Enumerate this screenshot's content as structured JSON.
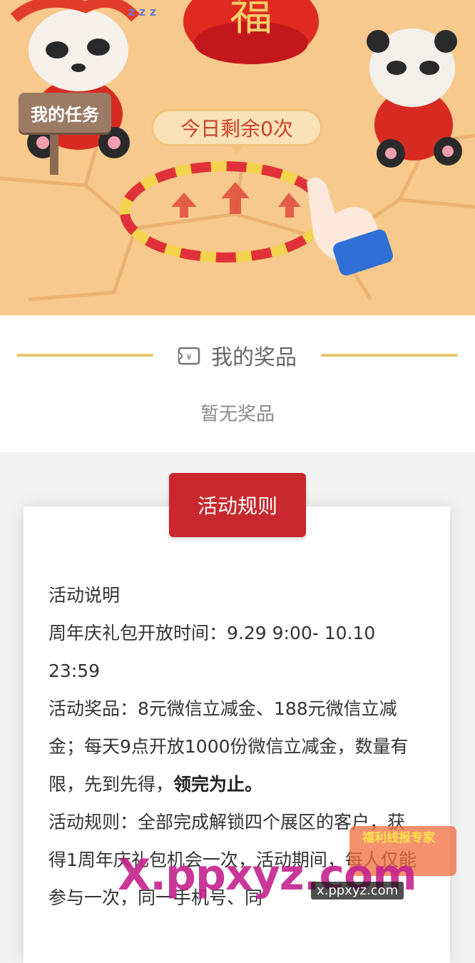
{
  "hero": {
    "task_button": "我的任务",
    "remaining_text": "今日剩余0次",
    "lantern_text": "福",
    "sleep_text": "z z z"
  },
  "prize": {
    "title": "我的奖品",
    "empty_text": "暂无奖品"
  },
  "rules": {
    "button_label": "活动规则",
    "heading": "活动说明",
    "open_time": "周年庆礼包开放时间：9.29 9:00- 10.10 23:59",
    "prizes_prefix": "活动奖品：8元微信立减金、188元微信立减金；每天9点开放1000份微信立减金，数量有限，先到先得，",
    "prizes_bold": "领完为止。",
    "rule_text": "活动规则：全部完成解锁四个展区的客户，获得1周年庆礼包机会一次，活动期间，每人仅能参与一次，同一手机号、同"
  },
  "watermark": {
    "main": "X.ppxyz.com",
    "small": "x.ppxyz.com",
    "badge": "福利线报专家"
  }
}
